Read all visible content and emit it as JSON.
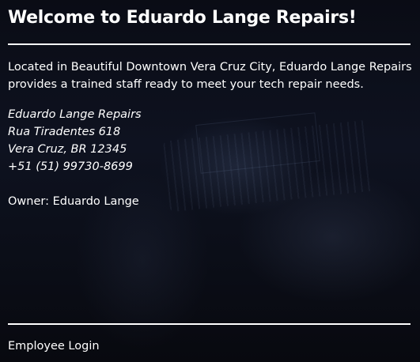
{
  "header": {
    "title": "Welcome to Eduardo Lange Repairs!"
  },
  "intro": {
    "text": "Located in Beautiful Downtown Vera Cruz City, Eduardo Lange Repairs provides a trained staff ready to meet your tech repair needs."
  },
  "address": {
    "name": "Eduardo Lange Repairs",
    "street": "Rua Tiradentes 618",
    "city": "Vera Cruz, BR 12345",
    "phone": "+51 (51) 99730-8699"
  },
  "owner": {
    "text": "Owner: Eduardo Lange"
  },
  "footer": {
    "login_label": "Employee Login"
  },
  "colors": {
    "text": "#ffffff",
    "background": "#0a0c14"
  }
}
